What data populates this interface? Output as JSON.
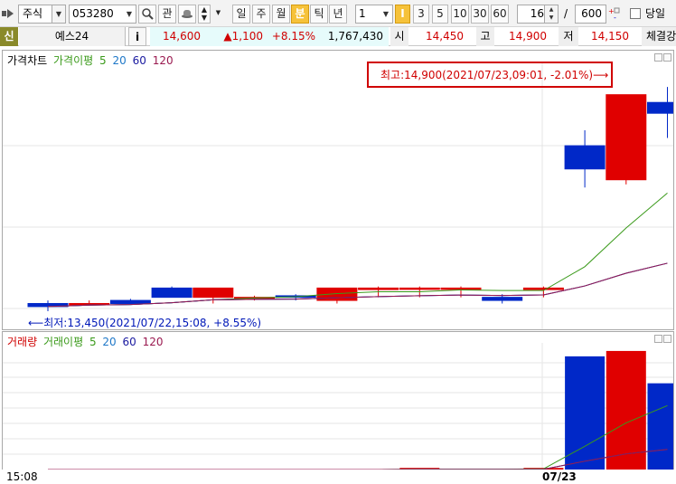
{
  "toolbar": {
    "market_type": "주식",
    "stock_code": "053280",
    "search_icon": "magnifier-icon",
    "interest_label": "관",
    "period_buttons": [
      "일",
      "주",
      "월",
      "분",
      "틱",
      "년"
    ],
    "active_period": "분",
    "interval_value": "1",
    "minute_buttons": [
      "I",
      "3",
      "5",
      "10",
      "30",
      "60"
    ],
    "active_minute": "I",
    "bar_count": "16",
    "separator": "/",
    "total_count": "600",
    "today_label": "당일"
  },
  "info": {
    "market_badge": "신",
    "stock_name": "예스24",
    "info_button": "i",
    "price": "14,600",
    "change": "▲1,100",
    "change_rate": "+8.15%",
    "volume": "1,767,430",
    "open_label": "시",
    "open_value": "14,450",
    "high_label": "고",
    "high_value": "14,900",
    "low_label": "저",
    "low_value": "14,150",
    "strength_label": "체결강"
  },
  "price_panel": {
    "title": "가격차트",
    "ma_label": "가격이평",
    "ma_periods": [
      "5",
      "20",
      "60",
      "120"
    ],
    "high_annotation": "최고:14,900(2021/07/23,09:01, -2.01%)⟶",
    "low_annotation": "⟵최저:13,450(2021/07/22,15:08, +8.55%)"
  },
  "volume_panel": {
    "title": "거래량",
    "ma_label": "거래이평",
    "ma_periods": [
      "5",
      "20",
      "60",
      "120"
    ]
  },
  "x_axis": {
    "start_label": "15:08",
    "date_label": "07/23"
  },
  "colors": {
    "up": "#e00000",
    "down": "#0028c8",
    "ma5": "#3a9a1a",
    "ma20": "#1f78c8",
    "ma60": "#1a1aa0",
    "ma120": "#9a1a50",
    "highlight": "#f6c23a"
  },
  "chart_data": {
    "type": "candlestick",
    "series": [
      {
        "name": "가격차트",
        "candles": [
          {
            "o": 13500,
            "h": 13520,
            "l": 13450,
            "c": 13480
          },
          {
            "o": 13500,
            "h": 13520,
            "l": 13490,
            "c": 13500
          },
          {
            "o": 13520,
            "h": 13530,
            "l": 13500,
            "c": 13500
          },
          {
            "o": 13600,
            "h": 13610,
            "l": 13540,
            "c": 13540
          },
          {
            "o": 13540,
            "h": 13600,
            "l": 13500,
            "c": 13600
          },
          {
            "o": 13540,
            "h": 13550,
            "l": 13520,
            "c": 13540
          },
          {
            "o": 13550,
            "h": 13560,
            "l": 13520,
            "c": 13540
          },
          {
            "o": 13520,
            "h": 13600,
            "l": 13500,
            "c": 13600
          },
          {
            "o": 13590,
            "h": 13610,
            "l": 13540,
            "c": 13600
          },
          {
            "o": 13600,
            "h": 13610,
            "l": 13540,
            "c": 13600
          },
          {
            "o": 13600,
            "h": 13610,
            "l": 13540,
            "c": 13600
          },
          {
            "o": 13540,
            "h": 13560,
            "l": 13500,
            "c": 13520
          },
          {
            "o": 13590,
            "h": 13610,
            "l": 13540,
            "c": 13600
          },
          {
            "o": 14520,
            "h": 14620,
            "l": 14250,
            "c": 14370
          },
          {
            "o": 14300,
            "h": 14850,
            "l": 14270,
            "c": 14850
          },
          {
            "o": 14800,
            "h": 14900,
            "l": 14570,
            "c": 14730
          }
        ]
      },
      {
        "name": "거래량",
        "values": [
          0,
          0,
          0,
          0,
          0,
          0,
          0,
          0,
          0,
          6000,
          0,
          0,
          6000,
          420000,
          440000,
          320000
        ]
      }
    ],
    "annotations": {
      "high": 14900,
      "low": 13450
    }
  }
}
